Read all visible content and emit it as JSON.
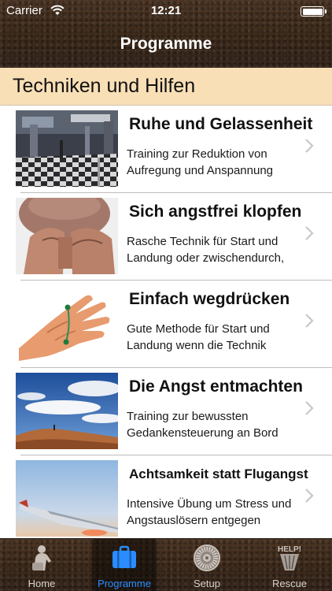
{
  "status_bar": {
    "carrier": "Carrier",
    "time": "12:21"
  },
  "nav": {
    "title": "Programme"
  },
  "section": {
    "title": "Techniken und Hilfen"
  },
  "items": [
    {
      "title": "Ruhe und Gelassenheit",
      "description": "Training zur Reduktion von Aufregung und Anspannung",
      "image": "airport-terminal-photo"
    },
    {
      "title": "Sich angstfrei klopfen",
      "description": "Rasche Technik für Start und Landung oder zwischendurch,",
      "image": "tapping-forehead-photo"
    },
    {
      "title": "Einfach wegdrücken",
      "description": "Gute Methode für Start und Landung wenn die Technik",
      "image": "hand-pressure-points-photo"
    },
    {
      "title": "Die Angst entmachten",
      "description": "Training zur bewussten Gedankensteuerung an Bord",
      "image": "sky-landscape-photo"
    },
    {
      "title": "Achtsamkeit statt Flugangst",
      "description": "Intensive Übung um Stress und Angstauslösern entgegen",
      "image": "airplane-wing-photo"
    }
  ],
  "tabs": [
    {
      "label": "Home",
      "icon": "person-icon"
    },
    {
      "label": "Programme",
      "icon": "suitcase-icon"
    },
    {
      "label": "Setup",
      "icon": "turbine-icon"
    },
    {
      "label": "Rescue",
      "icon": "help-icon"
    }
  ],
  "colors": {
    "accent": "#2a8cff",
    "section_bg": "#f9dfb6",
    "bar_bg": "#3d2a1c"
  }
}
